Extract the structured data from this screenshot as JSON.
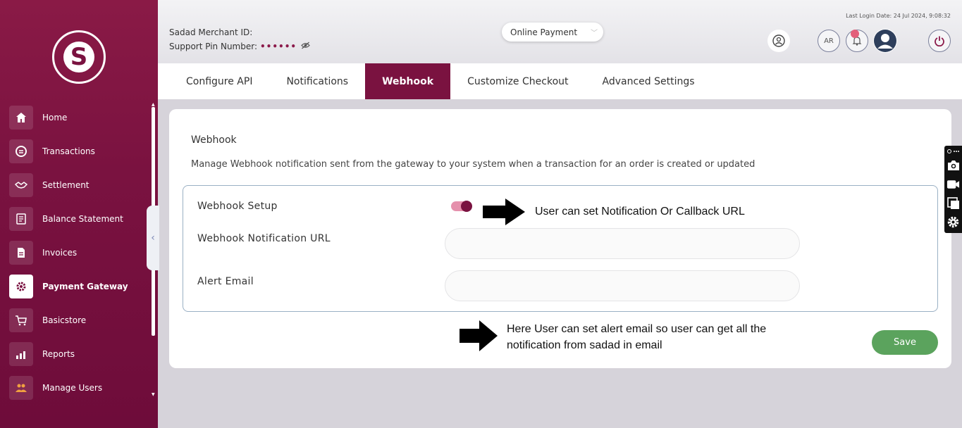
{
  "sidebar": {
    "items": [
      {
        "label": "Home",
        "icon": "home-icon"
      },
      {
        "label": "Transactions",
        "icon": "transactions-icon"
      },
      {
        "label": "Settlement",
        "icon": "handshake-icon"
      },
      {
        "label": "Balance Statement",
        "icon": "statement-icon"
      },
      {
        "label": "Invoices",
        "icon": "invoice-icon"
      },
      {
        "label": "Payment Gateway",
        "icon": "gear-icon"
      },
      {
        "label": "Basicstore",
        "icon": "cart-icon"
      },
      {
        "label": "Reports",
        "icon": "chart-icon"
      },
      {
        "label": "Manage Users",
        "icon": "users-icon"
      }
    ],
    "active_item": "Payment Gateway"
  },
  "header": {
    "merchant_label": "Sadad Merchant ID:",
    "pin_label": "Support Pin Number:",
    "pin_masked": "••••••",
    "last_login": "Last Login Date: 24 Jul 2024, 9:08:32",
    "mode": "Online Payment",
    "lang_button": "AR"
  },
  "tabs": [
    {
      "label": "Configure API"
    },
    {
      "label": "Notifications"
    },
    {
      "label": "Webhook",
      "active": true
    },
    {
      "label": "Customize Checkout"
    },
    {
      "label": "Advanced Settings"
    }
  ],
  "webhook": {
    "title": "Webhook",
    "description": "Manage Webhook notification sent from the gateway to your system when a transaction for an order is created or updated",
    "setup_label": "Webhook Setup",
    "setup_enabled": true,
    "notification_url_label": "Webhook Notification URL",
    "notification_url_value": "",
    "alert_email_label": "Alert Email",
    "alert_email_value": "",
    "save_label": "Save"
  },
  "annotations": {
    "callback_note": "User can set Notification Or Callback URL",
    "email_note_line1": "Here User can set alert email so user can get all the",
    "email_note_line2": "notification from sadad in email"
  },
  "colors": {
    "brand": "#7a1240",
    "save": "#5ba35d",
    "toggle_track": "#e590ac"
  }
}
